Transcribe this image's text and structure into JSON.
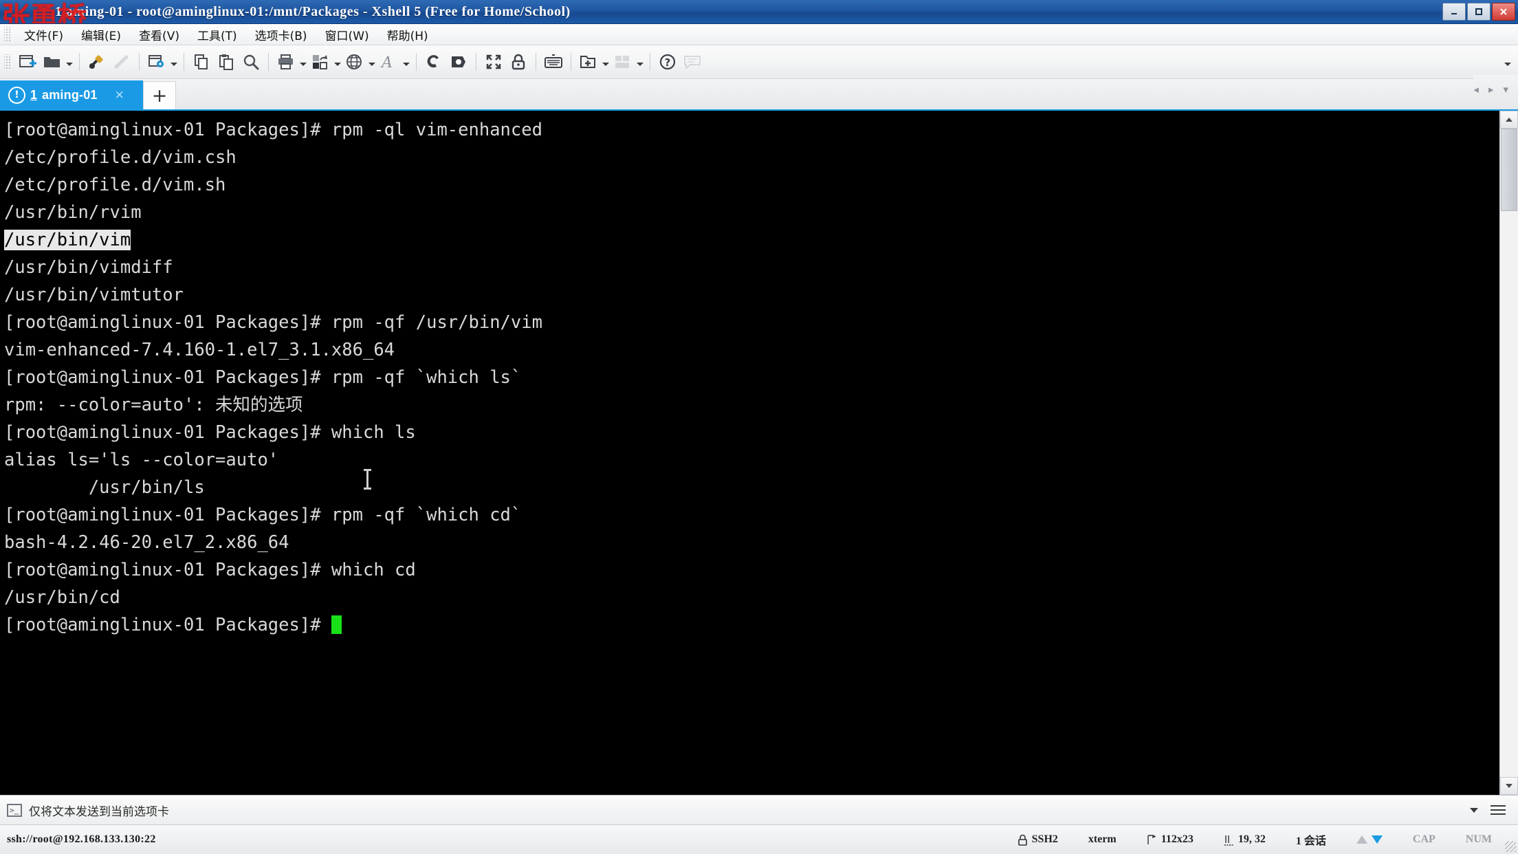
{
  "window": {
    "title": "1 aming-01 - root@aminglinux-01:/mnt/Packages - Xshell 5 (Free for Home/School)",
    "watermark": "张勇桥",
    "minimize_label": "—",
    "maximize_label": "□",
    "close_label": "✕"
  },
  "menu": {
    "items": [
      {
        "label": "文件(F)",
        "name": "file"
      },
      {
        "label": "编辑(E)",
        "name": "edit"
      },
      {
        "label": "查看(V)",
        "name": "view"
      },
      {
        "label": "工具(T)",
        "name": "tools"
      },
      {
        "label": "选项卡(B)",
        "name": "tabs"
      },
      {
        "label": "窗口(W)",
        "name": "window"
      },
      {
        "label": "帮助(H)",
        "name": "help"
      }
    ]
  },
  "toolbar": {
    "icons": [
      "new-session-icon",
      "open-folder-icon",
      "connect-icon",
      "disconnect-icon",
      "session-properties-icon",
      "copy-icon",
      "paste-icon",
      "find-icon",
      "print-icon",
      "color-scheme-icon",
      "globe-icon",
      "font-icon",
      "log-icon",
      "log-stop-icon",
      "fullscreen-icon",
      "lock-icon",
      "keyboard-icon",
      "add-folder-icon",
      "layout-icon",
      "help-icon",
      "feedback-icon"
    ],
    "overflow_label": "▾"
  },
  "tabs": {
    "active": {
      "warn_glyph": "!",
      "number": "1",
      "label": "aming-01",
      "close_glyph": "×"
    },
    "new_tab_glyph": "+",
    "nav_prev": "◂",
    "nav_next": "▸",
    "nav_menu": "▾"
  },
  "terminal": {
    "cols_rows": "112x23",
    "lines": [
      {
        "text": "[root@aminglinux-01 Packages]# rpm -ql vim-enhanced"
      },
      {
        "text": "/etc/profile.d/vim.csh"
      },
      {
        "text": "/etc/profile.d/vim.sh"
      },
      {
        "text": "/usr/bin/rvim"
      },
      {
        "text": "/usr/bin/vim",
        "selected": true
      },
      {
        "text": "/usr/bin/vimdiff"
      },
      {
        "text": "/usr/bin/vimtutor"
      },
      {
        "text": "[root@aminglinux-01 Packages]# rpm -qf /usr/bin/vim"
      },
      {
        "text": "vim-enhanced-7.4.160-1.el7_3.1.x86_64"
      },
      {
        "text": "[root@aminglinux-01 Packages]# rpm -qf `which ls`"
      },
      {
        "text": "rpm: --color=auto': 未知的选项"
      },
      {
        "text": "[root@aminglinux-01 Packages]# which ls"
      },
      {
        "text": "alias ls='ls --color=auto'"
      },
      {
        "text": "        /usr/bin/ls"
      },
      {
        "text": "[root@aminglinux-01 Packages]# rpm -qf `which cd`"
      },
      {
        "text": "bash-4.2.46-20.el7_2.x86_64"
      },
      {
        "text": "[root@aminglinux-01 Packages]# which cd"
      },
      {
        "text": "/usr/bin/cd"
      },
      {
        "text": "[root@aminglinux-01 Packages]# ",
        "cursor": true
      }
    ]
  },
  "sendbar": {
    "icon": "command-prompt-icon",
    "text": "仅将文本发送到当前选项卡",
    "dropdown_glyph": "▾",
    "menu_glyph": "≡"
  },
  "statusbar": {
    "url": "ssh://root@192.168.133.130:22",
    "protocol": "SSH2",
    "terminal_type": "xterm",
    "size": "112x23",
    "cursor_pos": "19, 32",
    "sessions": "1 会话",
    "cap": "CAP",
    "num": "NUM"
  }
}
